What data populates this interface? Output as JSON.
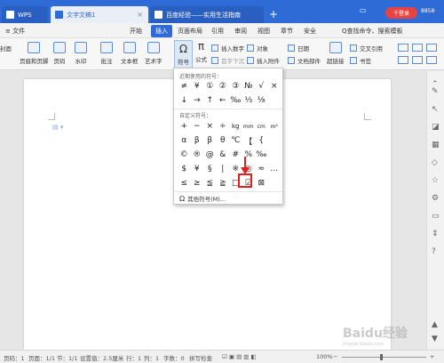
{
  "titlebar": {
    "tabs": [
      {
        "label": "WPS"
      },
      {
        "label": "文字文稿1"
      },
      {
        "label": "百度经验——实用生活指南"
      }
    ],
    "plus": "+",
    "login_label": "千登录",
    "user_text": "8858·"
  },
  "menubar": {
    "file": "≡ 文件",
    "items": [
      "开始",
      "插入",
      "页面布局",
      "引用",
      "审阅",
      "视图",
      "章节",
      "安全"
    ],
    "search": "Q查找命令、搜索模板"
  },
  "ribbon": {
    "left_partial": "封面",
    "buttons": [
      "页眉和页脚",
      "页码",
      "水印",
      "批注",
      "文本框",
      "艺术字",
      "符号",
      "公式"
    ],
    "small_buttons": [
      "插入数字",
      "对象",
      "日期",
      "超链接",
      "书签",
      "交叉引用",
      "插入附件",
      "首字下沉",
      "文档部件"
    ]
  },
  "dropdown": {
    "recent_title": "近期使用的符号：",
    "recent_row1": [
      "≠",
      "¥",
      "①",
      "②",
      "③",
      "№",
      "√",
      "×"
    ],
    "recent_row2": [
      "↓",
      "→",
      "↑",
      "←",
      "‰",
      "⅓",
      "⅛",
      ""
    ],
    "custom_title": "自定义符号：",
    "custom_rows": [
      [
        "+",
        "−",
        "×",
        "÷",
        "kg",
        "mm",
        "cm",
        "m²"
      ],
      [
        "α",
        "β",
        "β",
        "θ",
        "℃",
        "【",
        "{",
        ""
      ],
      [
        "©",
        "®",
        "@",
        "&",
        "#",
        "%",
        "‰",
        ""
      ],
      [
        "$",
        "¥",
        "§",
        "|",
        "※",
        "◎",
        "≈",
        "…"
      ],
      [
        "≤",
        "≥",
        "≦",
        "≧",
        "□",
        "☑",
        "⊠",
        ""
      ]
    ],
    "more_label": "其他符号(M)..."
  },
  "statusbar": {
    "page": "页码：1",
    "pages": "页面：1/1",
    "section": "节：1/1",
    "settings": "设置值：2.5厘米",
    "row": "行：1",
    "col": "列：1",
    "words": "字数：0",
    "spell": "拼写检查",
    "zoom": "100%",
    "zoom_minus": "−",
    "zoom_plus": "+"
  },
  "watermark": {
    "text": "Baidu经验",
    "sub": "jingyan.baidu.com"
  },
  "colors": {
    "accent": "#2f6bd6",
    "highlight": "#e02020"
  }
}
